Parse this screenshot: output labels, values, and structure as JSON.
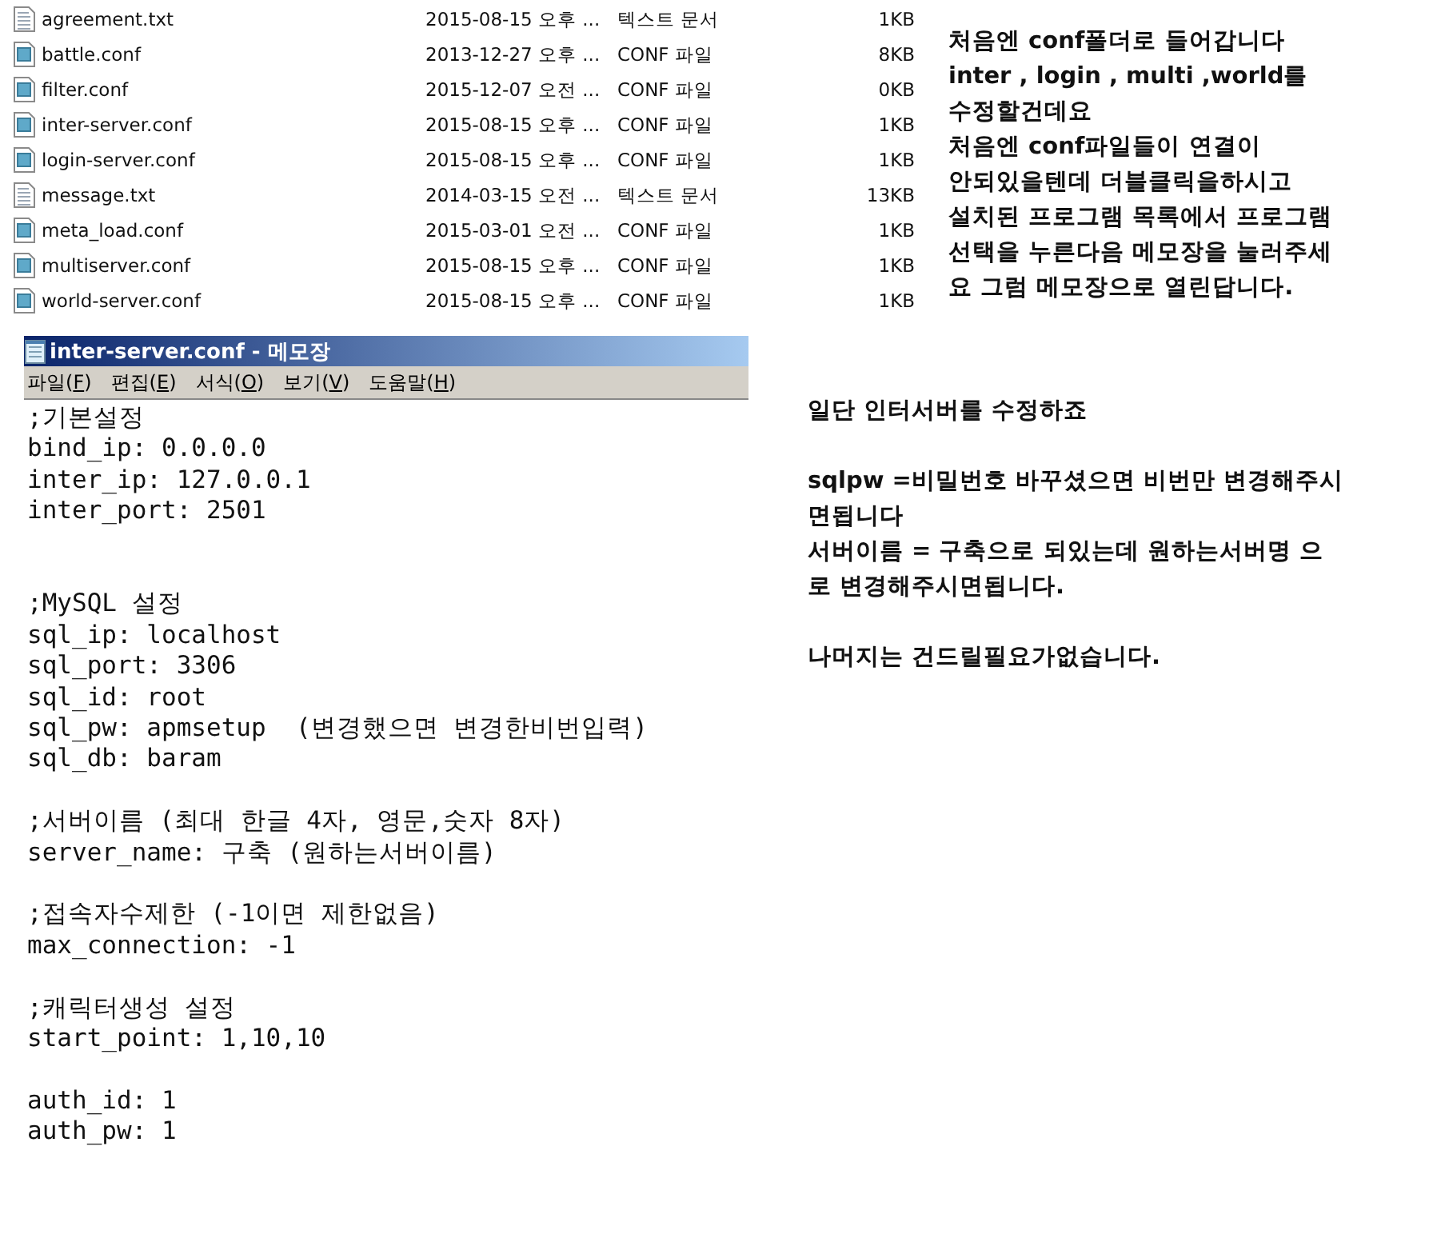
{
  "file_list": [
    {
      "name": "agreement.txt",
      "date": "2015-08-15 오후 ...",
      "type": "텍스트 문서",
      "size": "1KB",
      "kind": "text"
    },
    {
      "name": "battle.conf",
      "date": "2013-12-27 오후 ...",
      "type": "CONF 파일",
      "size": "8KB",
      "kind": "conf"
    },
    {
      "name": "filter.conf",
      "date": "2015-12-07 오전 ...",
      "type": "CONF 파일",
      "size": "0KB",
      "kind": "conf"
    },
    {
      "name": "inter-server.conf",
      "date": "2015-08-15 오후 ...",
      "type": "CONF 파일",
      "size": "1KB",
      "kind": "conf"
    },
    {
      "name": "login-server.conf",
      "date": "2015-08-15 오후 ...",
      "type": "CONF 파일",
      "size": "1KB",
      "kind": "conf"
    },
    {
      "name": "message.txt",
      "date": "2014-03-15 오전 ...",
      "type": "텍스트 문서",
      "size": "13KB",
      "kind": "text"
    },
    {
      "name": "meta_load.conf",
      "date": "2015-03-01 오전 ...",
      "type": "CONF 파일",
      "size": "1KB",
      "kind": "conf"
    },
    {
      "name": "multiserver.conf",
      "date": "2015-08-15 오후 ...",
      "type": "CONF 파일",
      "size": "1KB",
      "kind": "conf"
    },
    {
      "name": "world-server.conf",
      "date": "2015-08-15 오후 ...",
      "type": "CONF 파일",
      "size": "1KB",
      "kind": "conf"
    }
  ],
  "notepad": {
    "title": "inter-server.conf - 메모장",
    "menu": [
      "파일(F)",
      "편집(E)",
      "서식(O)",
      "보기(V)",
      "도움말(H)"
    ],
    "sections": [
      [
        ";기본설정",
        "bind_ip: 0.0.0.0",
        "inter_ip: 127.0.0.1",
        "inter_port: 2501"
      ],
      [
        ";MySQL 설정",
        "sql_ip: localhost",
        "sql_port: 3306",
        "sql_id: root",
        "sql_pw: apmsetup  (변경했으면 변경한비번입력)",
        "sql_db: baram"
      ],
      [
        ";서버이름 (최대 한글 4자, 영문,숫자 8자)",
        "server_name: 구축 (원하는서버이름)"
      ],
      [
        ";접속자수제한 (-1이면 제한없음)",
        "max_connection: -1"
      ],
      [
        ";캐릭터생성 설정",
        "start_point: 1,10,10"
      ],
      [
        "auth_id: 1",
        "auth_pw: 1"
      ]
    ]
  },
  "instructions_1": [
    "처음엔 conf폴더로 들어갑니다",
    "inter , login , multi ,world를",
    "수정할건데요",
    "처음엔 conf파일들이 연결이",
    "안되있을텐데 더블클릭을하시고",
    "설치된 프로그램 목록에서 프로그램",
    "선택을 누른다음 메모장을 눌러주세",
    "요 그럼 메모장으로 열린답니다."
  ],
  "instructions_2": [
    [
      "일단 인터서버를 수정하죠"
    ],
    [
      "sqlpw =비밀번호 바꾸셨으면 비번만 변경해주시",
      "면됩니다",
      "서버이름 = 구축으로 되있는데 원하는서버명 으",
      "로 변경해주시면됩니다."
    ],
    [
      "나머지는 건드릴필요가없습니다."
    ]
  ]
}
